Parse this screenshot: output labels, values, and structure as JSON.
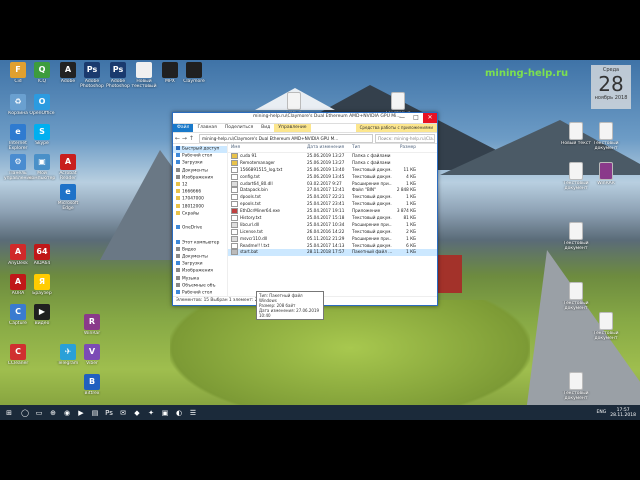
{
  "watermark": "mining-help.ru",
  "calendar": {
    "weekday": "Среда",
    "day": "28",
    "month": "ноябрь 2018"
  },
  "desktop_left": [
    {
      "label": "Cid",
      "color": "#e0a030",
      "glyph": "F"
    },
    {
      "label": "ICQ",
      "color": "#3d9c3d",
      "glyph": "Q"
    },
    {
      "label": "Adobe",
      "color": "#222222",
      "glyph": "A"
    },
    {
      "label": "Adobe Photoshop",
      "color": "#1a3a6e",
      "glyph": "Ps"
    },
    {
      "label": "Adobe Photoshop",
      "color": "#1a3a6e",
      "glyph": "Ps"
    },
    {
      "label": "Новый текстовый",
      "color": "#f0f0f0",
      "glyph": ""
    },
    {
      "label": "MPX",
      "color": "#202020",
      "glyph": ""
    },
    {
      "label": "Claymore",
      "color": "#202020",
      "glyph": ""
    },
    {
      "label": "Корзина",
      "color": "#6aa0d0",
      "glyph": "♻"
    },
    {
      "label": "OpenOffice",
      "color": "#2c9be0",
      "glyph": "O"
    },
    {
      "label": "Internet Explorer",
      "color": "#2f7bd0",
      "glyph": "e"
    },
    {
      "label": "Skype",
      "color": "#00aff0",
      "glyph": "S"
    },
    {
      "label": "Панель управления",
      "color": "#4a8cd0",
      "glyph": "⚙"
    },
    {
      "label": "Мой компьютер",
      "color": "#4a90c8",
      "glyph": "▣"
    },
    {
      "label": "Acrobat Reader",
      "color": "#c81e1e",
      "glyph": "A"
    },
    {
      "label": "Microsoft Edge",
      "color": "#1e72c8",
      "glyph": "e"
    },
    {
      "label": "AnyDesk",
      "color": "#d02a2a",
      "glyph": "A"
    },
    {
      "label": "AIDA64",
      "color": "#c01818",
      "glyph": "64"
    },
    {
      "label": "AURA",
      "color": "#c01818",
      "glyph": "A"
    },
    {
      "label": "Браузер",
      "color": "#ffcc00",
      "glyph": "Я"
    },
    {
      "label": "Capture",
      "color": "#3a7bd0",
      "glyph": "C"
    },
    {
      "label": "Видео",
      "color": "#202020",
      "glyph": "▶"
    },
    {
      "label": "CCleaner",
      "color": "#d03030",
      "glyph": "C"
    },
    {
      "label": "Telegram",
      "color": "#2aa0d8",
      "glyph": "✈"
    },
    {
      "label": "Viber",
      "color": "#7c4bb6",
      "glyph": "V"
    },
    {
      "label": "WinRar",
      "color": "#8a3a8a",
      "glyph": "R"
    },
    {
      "label": "Bittrex",
      "color": "#2060c0",
      "glyph": "B"
    }
  ],
  "desktop_right": [
    {
      "label": "Новый документ",
      "color": "#f4f4f4"
    },
    {
      "label": "Текстовый документ",
      "color": "#f4f4f4"
    },
    {
      "label": "Новый текст",
      "color": "#f4f4f4"
    },
    {
      "label": "Текстовый документ",
      "color": "#f4f4f4"
    },
    {
      "label": "Текстовый документ",
      "color": "#f4f4f4"
    },
    {
      "label": "WinRAR",
      "color": "#8a3a8a"
    },
    {
      "label": "Текстовый документ",
      "color": "#f4f4f4"
    },
    {
      "label": "Текстовый документ",
      "color": "#f4f4f4"
    },
    {
      "label": "Текстовый документ",
      "color": "#f4f4f4"
    },
    {
      "label": "Текстовый документ",
      "color": "#f4f4f4"
    }
  ],
  "window": {
    "title": "mining-help.ru\\Claymore's Dual Ethereum AMD+NVIDIA GPU Mi...",
    "context_tab": "Средства работы с приложениями",
    "controls": {
      "minimize": "—",
      "maximize": "□",
      "close": "✕"
    },
    "ribbon": {
      "file": "Файл",
      "home": "Главная",
      "share": "Поделиться",
      "view": "Вид",
      "manage": "Управление"
    },
    "address": "mining-help.ru\\Claymore's Dual Ethereum AMD+NVIDIA GPU M...",
    "search_placeholder": "Поиск: mining-help.ru\\Cla...",
    "nav_back": "←  →  ↑",
    "nav": [
      {
        "label": "Быстрый доступ",
        "color": "#2b6cbf",
        "selected": true
      },
      {
        "label": "Рабочий стол",
        "color": "#3f89d8",
        "selected": false
      },
      {
        "label": "Загрузки",
        "color": "#3f89d8",
        "selected": false
      },
      {
        "label": "Документы",
        "color": "#8a8a8a",
        "selected": false
      },
      {
        "label": "Изображения",
        "color": "#8a8a8a",
        "selected": false
      },
      {
        "label": "12",
        "color": "#e8c24a",
        "selected": false
      },
      {
        "label": "1666666",
        "color": "#e8c24a",
        "selected": false
      },
      {
        "label": "17047000",
        "color": "#e8c24a",
        "selected": false
      },
      {
        "label": "18012000",
        "color": "#e8c24a",
        "selected": false
      },
      {
        "label": "Скрайы",
        "color": "#e8c24a",
        "selected": false
      },
      {
        "label": "",
        "color": "transparent",
        "selected": false
      },
      {
        "label": "OneDrive",
        "color": "#3f89d8",
        "selected": false
      },
      {
        "label": "",
        "color": "transparent",
        "selected": false
      },
      {
        "label": "Этот компьютер",
        "color": "#3f89d8",
        "selected": false
      },
      {
        "label": "Видео",
        "color": "#8a8a8a",
        "selected": false
      },
      {
        "label": "Документы",
        "color": "#8a8a8a",
        "selected": false
      },
      {
        "label": "Загрузки",
        "color": "#3f89d8",
        "selected": false
      },
      {
        "label": "Изображения",
        "color": "#8a8a8a",
        "selected": false
      },
      {
        "label": "Музыка",
        "color": "#8a8a8a",
        "selected": false
      },
      {
        "label": "Объемные объ",
        "color": "#8a8a8a",
        "selected": false
      },
      {
        "label": "Рабочий стол",
        "color": "#3f89d8",
        "selected": false
      }
    ],
    "columns": {
      "name": "Имя",
      "date": "Дата изменения",
      "type": "Тип",
      "size": "Размер"
    },
    "files": [
      {
        "name": "cuda 91",
        "date": "25.06.2019 13:27",
        "type": "Папка с файлами",
        "size": "",
        "icon": "#e8c24a"
      },
      {
        "name": "Remotemanager",
        "date": "25.06.2019 13:27",
        "type": "Папка с файлами",
        "size": "",
        "icon": "#e8c24a"
      },
      {
        "name": "1566891515_log.txt",
        "date": "25.06.2019 13:40",
        "type": "Текстовый докум...",
        "size": "11 КБ",
        "icon": "#ffffff"
      },
      {
        "name": "config.txt",
        "date": "25.06.2019 13:45",
        "type": "Текстовый докум...",
        "size": "4 КБ",
        "icon": "#ffffff"
      },
      {
        "name": "cudart64_80.dll",
        "date": "03.02.2017 9:27",
        "type": "Расширение при...",
        "size": "1 КБ",
        "icon": "#dddddd"
      },
      {
        "name": "Datapack.bin",
        "date": "27.04.2017 12:41",
        "type": "Файл \"BIN\"",
        "size": "2 848 КБ",
        "icon": "#ffffff"
      },
      {
        "name": "dpools.txt",
        "date": "25.04.2017 22:21",
        "type": "Текстовый докум...",
        "size": "1 КБ",
        "icon": "#ffffff"
      },
      {
        "name": "epools.txt",
        "date": "25.04.2017 23:41",
        "type": "Текстовый докум...",
        "size": "1 КБ",
        "icon": "#ffffff"
      },
      {
        "name": "EthDcrMiner64.exe",
        "date": "25.04.2017 19:11",
        "type": "Приложение",
        "size": "3 874 КБ",
        "icon": "#c04040"
      },
      {
        "name": "History.txt",
        "date": "25.04.2017 15:18",
        "type": "Текстовый докум...",
        "size": "81 КБ",
        "icon": "#ffffff"
      },
      {
        "name": "libcurl.dll",
        "date": "25.04.2017 10:34",
        "type": "Расширение при...",
        "size": "1 КБ",
        "icon": "#dddddd"
      },
      {
        "name": "License.txt",
        "date": "26.04.2016 14:22",
        "type": "Текстовый докум...",
        "size": "2 КБ",
        "icon": "#ffffff"
      },
      {
        "name": "msvcr110.dll",
        "date": "05.11.2012 21:29",
        "type": "Расширение при...",
        "size": "1 КБ",
        "icon": "#dddddd"
      },
      {
        "name": "Readme!!!.txt",
        "date": "25.04.2017 14:13",
        "type": "Текстовый докум...",
        "size": "6 КБ",
        "icon": "#ffffff"
      },
      {
        "name": "start.bat",
        "date": "28.11.2018 17:57",
        "type": "Пакетный файл ...",
        "size": "1 КБ",
        "icon": "#bbbbbb",
        "selected": true
      }
    ],
    "tooltip": {
      "line1": "Тип: Пакетный файл Windows",
      "line2": "Размер: 208 байт",
      "line3": "Дата изменения: 27.06.2019 10:40"
    },
    "status": "Элементов: 15    Выбран 1 элемент: 208 байт"
  },
  "taskbar": {
    "start_glyph": "⊞",
    "items": [
      "◯",
      "▭",
      "⊕",
      "◉",
      "▶",
      "▤",
      "Ps",
      "✉",
      "◆",
      "✦",
      "▣",
      "◐",
      "☰"
    ],
    "lang": "ENG",
    "time": "17:57",
    "date": "28.11.2018"
  }
}
